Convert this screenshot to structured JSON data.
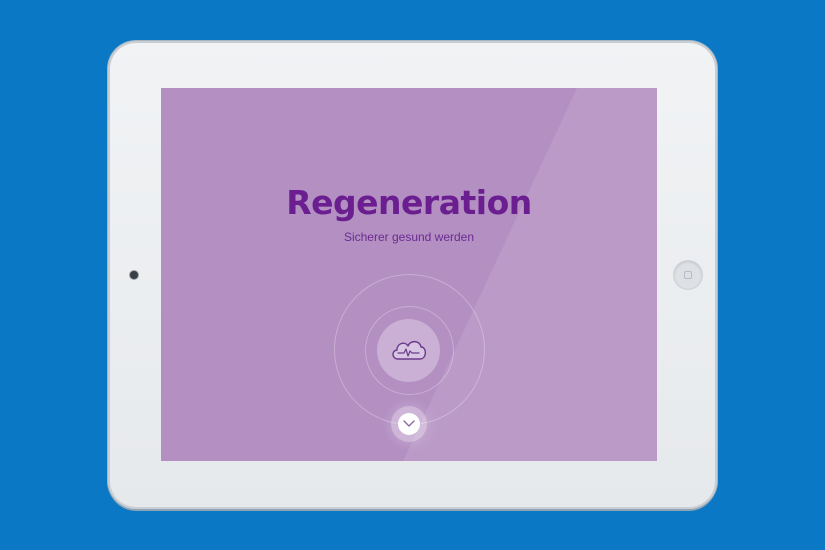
{
  "screen": {
    "title": "Regeneration",
    "subtitle": "Sicherer gesund werden",
    "center_icon": "cloud-heartbeat-icon",
    "scroll_icon": "chevron-down-icon"
  },
  "colors": {
    "background": "#0a78c5",
    "screen": "#b38fc2",
    "title": "#6a1e8f"
  }
}
